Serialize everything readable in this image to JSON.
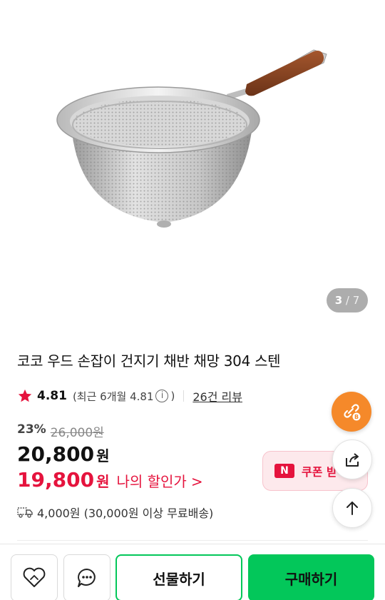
{
  "gallery": {
    "current": "3",
    "separator": "/",
    "total": "7"
  },
  "product": {
    "title": "코코 우드 손잡이 건지기 채반 채망 304 스텐"
  },
  "rating": {
    "score": "4.81",
    "recent_prefix": "(최근 6개월 4.81",
    "info_glyph": "i",
    "recent_suffix": ")",
    "reviews_label": "26건 리뷰"
  },
  "pricing": {
    "discount_pct": "23%",
    "original_price": "26,000원",
    "sale_price": "20,800",
    "currency": "원",
    "my_price": "19,800",
    "my_price_currency": "원",
    "my_price_label": "나의 할인가",
    "my_price_chevron": ">"
  },
  "shipping": {
    "text": "4,000원 (30,000원 이상 무료배송)"
  },
  "coupon": {
    "badge": "N",
    "label": "쿠폰 받"
  },
  "bottom_bar": {
    "gift_label": "선물하기",
    "buy_label": "구매하기"
  },
  "colors": {
    "brand_green": "#03c75a",
    "sale_red": "#e5133d",
    "fab_orange": "#f5892a",
    "star": "#e5133d"
  },
  "icons": {
    "rating": "star-icon",
    "shipping": "truck-icon",
    "fab_link": "link-icon",
    "fab_share": "share-icon",
    "fab_top": "arrow-up-icon",
    "wishlist": "heart-icon",
    "chat": "chat-icon"
  }
}
